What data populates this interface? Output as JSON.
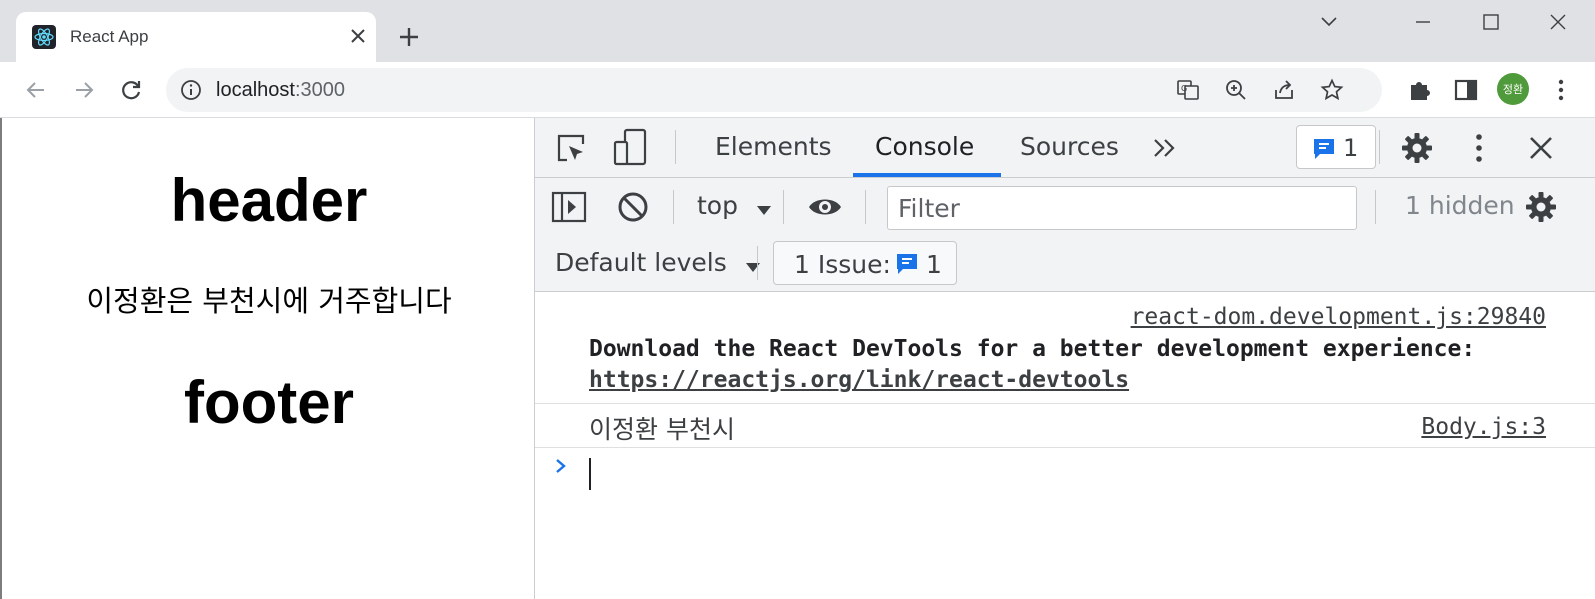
{
  "browser": {
    "tab": {
      "title": "React App",
      "favicon": "react-icon"
    },
    "address": {
      "host": "localhost",
      "port": ":3000"
    },
    "profile": {
      "initials": "정환",
      "color": "#4f9a3a"
    }
  },
  "page": {
    "header": "header",
    "body_text": "이정환은 부천시에 거주합니다",
    "footer": "footer"
  },
  "devtools": {
    "tabs": [
      {
        "label": "Elements"
      },
      {
        "label": "Console"
      },
      {
        "label": "Sources"
      }
    ],
    "active_tab": "Console",
    "messages_badge": "1",
    "context": "top",
    "filter_placeholder": "Filter",
    "hidden": "1 hidden",
    "levels": "Default levels",
    "issues": {
      "label": "1 Issue:",
      "count": "1"
    },
    "accent": "#1a73e8",
    "console": {
      "messages": [
        {
          "source": "react-dom.development.js:29840",
          "text": "Download the React DevTools for a better development experience:",
          "link": "https://reactjs.org/link/react-devtools"
        },
        {
          "source": "Body.js:3",
          "text": "이정환 부천시"
        }
      ]
    }
  }
}
